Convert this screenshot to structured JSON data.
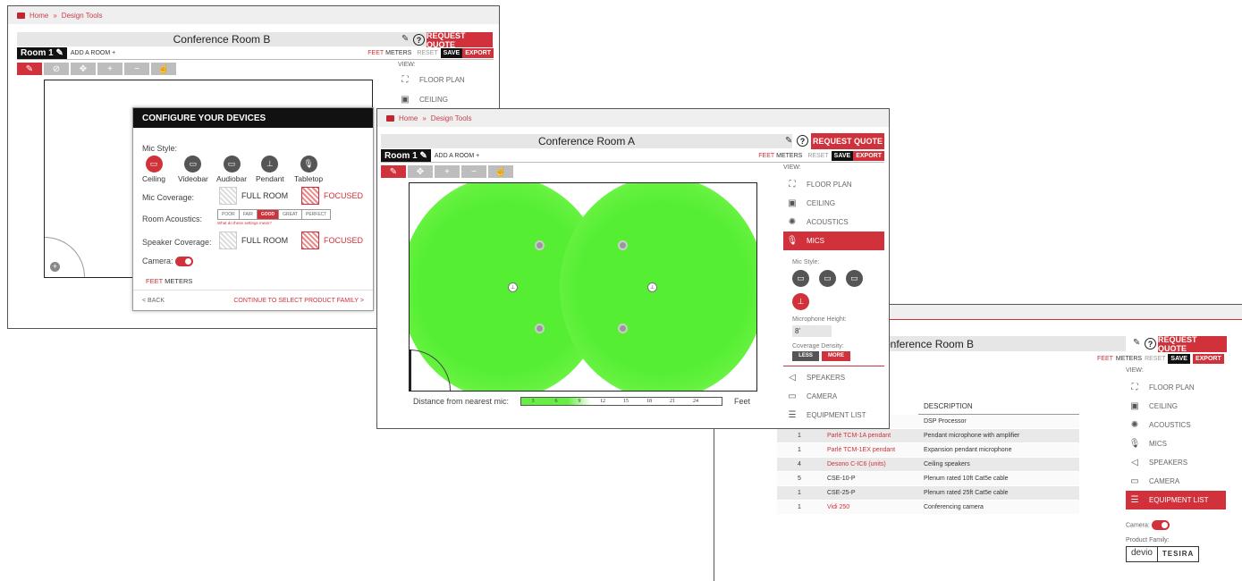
{
  "breadcrumb": {
    "home": "Home",
    "sep": "»",
    "tools": "Design Tools"
  },
  "room_b": {
    "title": "Conference Room B",
    "room_tab": "Room 1",
    "add_room": "ADD A ROOM +",
    "feet": "FEET",
    "meters": "METERS",
    "reset": "RESET",
    "save": "SAVE",
    "export": "EXPORT",
    "request_quote": "REQUEST QUOTE",
    "view_label": "VIEW:",
    "view_items": [
      "FLOOR PLAN",
      "CEILING"
    ]
  },
  "modal": {
    "title": "CONFIGURE YOUR DEVICES",
    "mic_style_label": "Mic Style:",
    "mic_styles": [
      "Ceiling",
      "Videobar",
      "Audiobar",
      "Pendant",
      "Tabletop"
    ],
    "mic_coverage_label": "Mic Coverage:",
    "full_room": "FULL ROOM",
    "focused": "FOCUSED",
    "acoustics_label": "Room Acoustics:",
    "acoustics": [
      "POOR",
      "FAIR",
      "GOOD",
      "GREAT",
      "PERFECT"
    ],
    "acoustics_help": "What do these settings mean?",
    "speaker_coverage_label": "Speaker Coverage:",
    "camera_label": "Camera:",
    "feet": "FEET",
    "meters": "METERS",
    "back": "< BACK",
    "continue": "CONTINUE TO SELECT PRODUCT FAMILY >"
  },
  "room_a": {
    "title": "Conference Room A",
    "room_tab": "Room 1",
    "add_room": "ADD A ROOM +",
    "feet": "FEET",
    "meters": "METERS",
    "reset": "RESET",
    "save": "SAVE",
    "export": "EXPORT",
    "request_quote": "REQUEST QUOTE",
    "view_label": "VIEW:",
    "view_items": [
      "FLOOR PLAN",
      "CEILING",
      "ACOUSTICS",
      "MICS"
    ],
    "mic_style_label": "Mic Style:",
    "mic_height_label": "Microphone Height:",
    "mic_height": "8'",
    "density_label": "Coverage Density:",
    "less": "LESS",
    "more": "MORE",
    "lower_items": [
      "SPEAKERS",
      "CAMERA",
      "EQUIPMENT LIST"
    ],
    "distance_label": "Distance from nearest mic:",
    "scale": [
      "3",
      "6",
      "9",
      "12",
      "15",
      "18",
      "21",
      "24"
    ],
    "scale_unit": "Feet"
  },
  "room_b2": {
    "title": "onference Room B",
    "feet": "FEET",
    "meters": "METERS",
    "reset": "RESET",
    "save": "SAVE",
    "export": "EXPORT",
    "request_quote": "REQUEST QUOTE",
    "view_label": "VIEW:",
    "view_items": [
      "FLOOR PLAN",
      "CEILING",
      "ACOUSTICS",
      "MICS",
      "SPEAKERS",
      "CAMERA",
      "EQUIPMENT LIST"
    ],
    "desc_header": "DESCRIPTION",
    "rows": [
      {
        "qty": "",
        "part": "",
        "desc": "DSP Processor"
      },
      {
        "qty": "1",
        "part": "Parlé TCM-1A pendant",
        "desc": "Pendant microphone with amplifier"
      },
      {
        "qty": "1",
        "part": "Parlé TCM-1EX pendant",
        "desc": "Expansion pendant microphone"
      },
      {
        "qty": "4",
        "part": "Desono C-IC6 (units)",
        "desc": "Ceiling speakers"
      },
      {
        "qty": "5",
        "part": "CSE-10-P",
        "desc": "Plenum rated 10ft Cat5e cable"
      },
      {
        "qty": "1",
        "part": "CSE-25-P",
        "desc": "Plenum rated 25ft Cat5e cable"
      },
      {
        "qty": "1",
        "part": "Vidi 250",
        "desc": "Conferencing camera"
      }
    ],
    "camera_label": "Camera:",
    "family_label": "Product Family:",
    "families": [
      "devio",
      "TESIRA"
    ]
  },
  "colors": {
    "accent": "#d0313a",
    "coverage": "#55ee33"
  }
}
